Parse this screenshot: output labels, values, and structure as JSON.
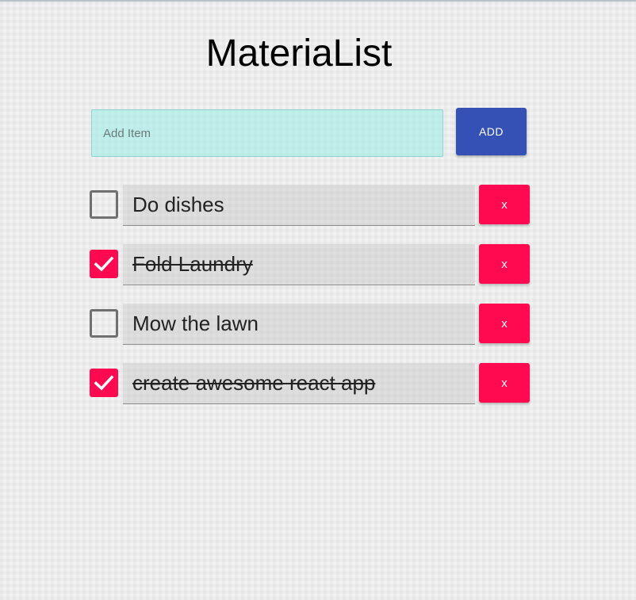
{
  "app": {
    "title": "MateriaList"
  },
  "add_form": {
    "input_value": "",
    "input_placeholder": "Add Item",
    "button_label": "ADD"
  },
  "todos": [
    {
      "text": "Do dishes",
      "completed": false,
      "delete_label": "x"
    },
    {
      "text": "Fold Laundry",
      "completed": true,
      "delete_label": "x"
    },
    {
      "text": "Mow the lawn",
      "completed": false,
      "delete_label": "x"
    },
    {
      "text": "create awesome react app",
      "completed": true,
      "delete_label": "x"
    }
  ],
  "colors": {
    "add_button": "#3551b5",
    "delete_button": "#ff0a50",
    "checkbox_checked": "#ff0a50",
    "checkbox_unchecked_border": "#707070",
    "input_background": "#a0ece8"
  },
  "icons": {
    "checked": "checkmark-icon"
  }
}
